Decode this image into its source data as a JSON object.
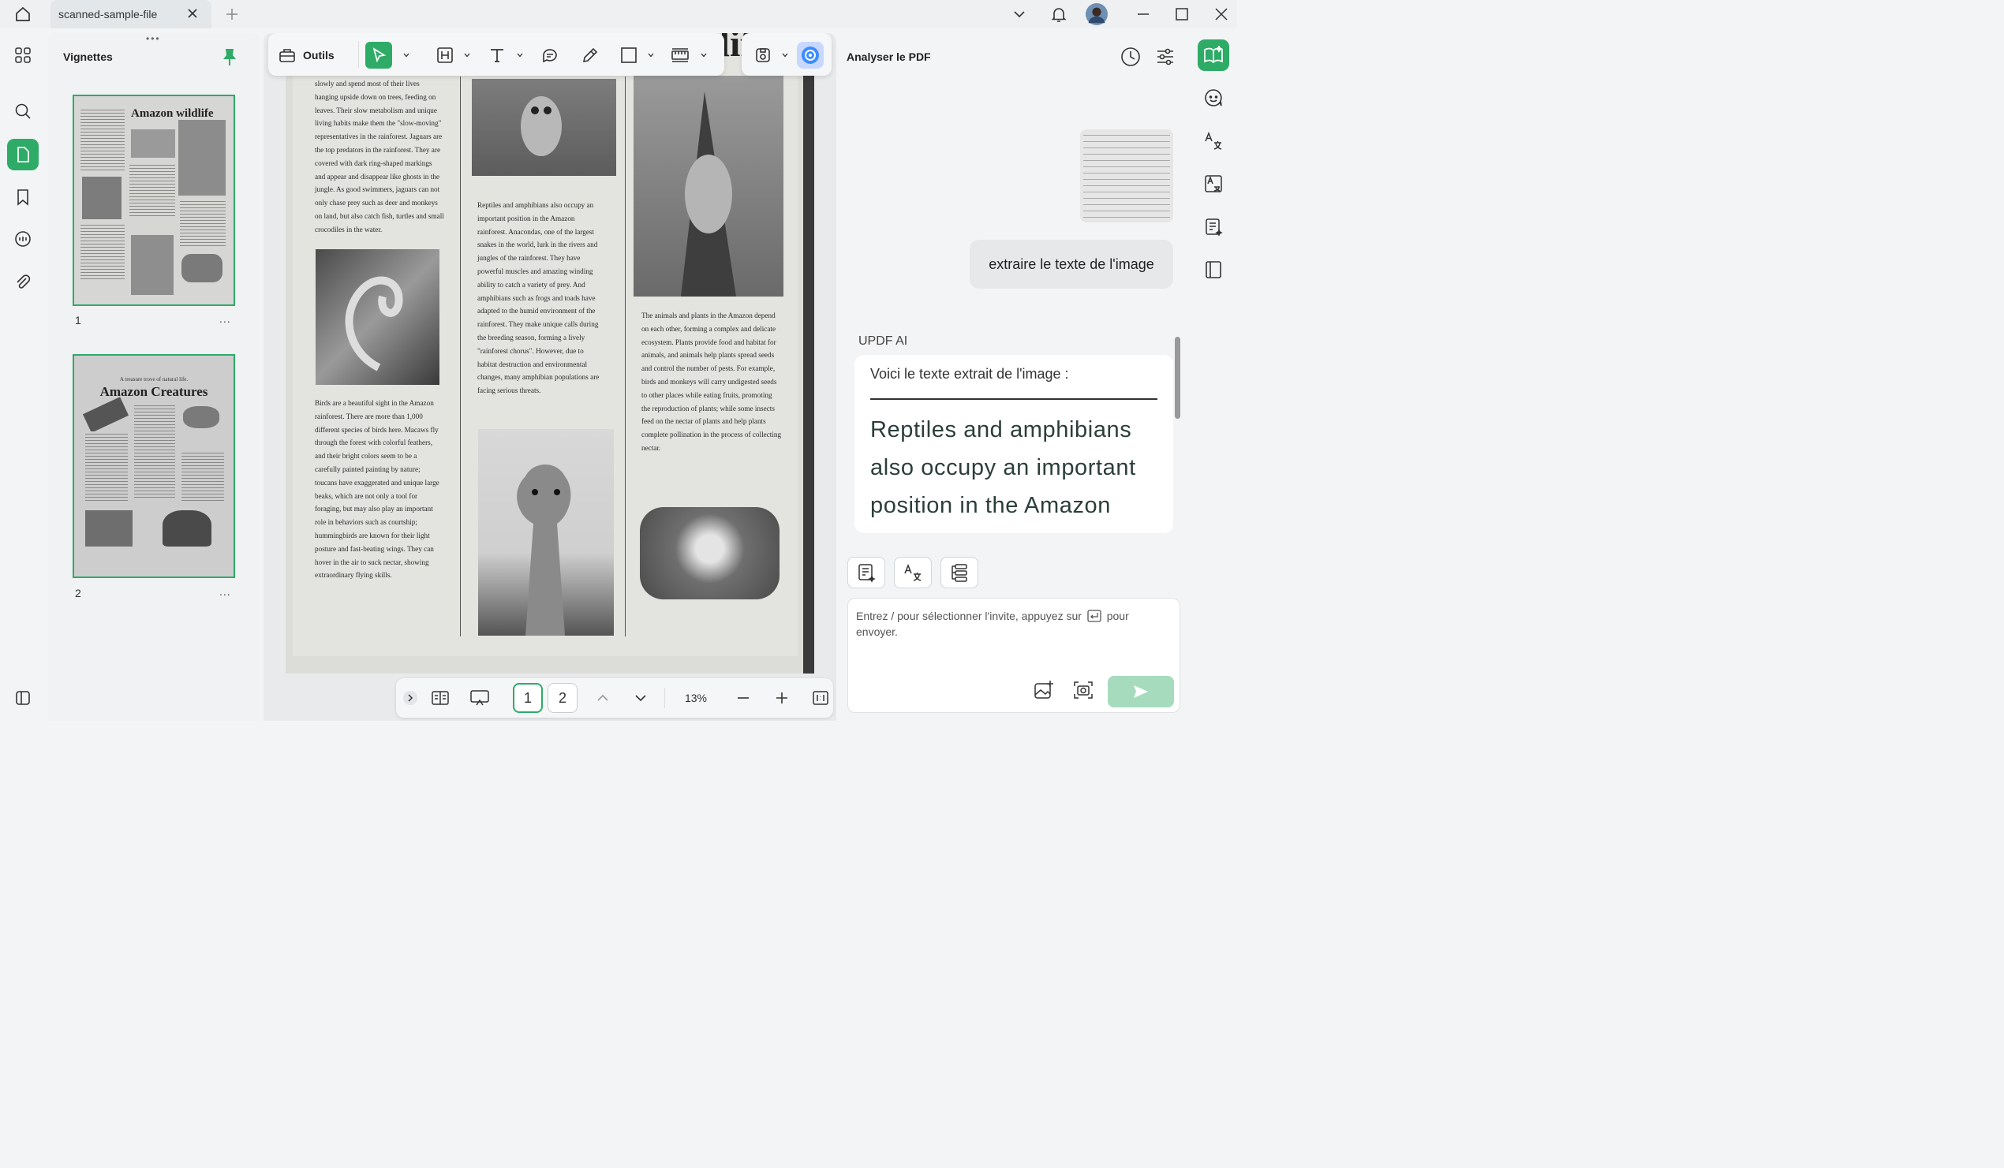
{
  "app": {
    "tab_title": "scanned-sample-file"
  },
  "thumbnails_panel": {
    "title": "Vignettes",
    "pages": [
      {
        "number": "1",
        "more": "...",
        "title": "Amazon wildlife"
      },
      {
        "number": "2",
        "more": "...",
        "kicker": "A treasure trove of natural life.",
        "title": "Amazon Creatures"
      }
    ]
  },
  "toolbar": {
    "tools_label": "Outils"
  },
  "document": {
    "title": "Amazon wildlife",
    "col1_top": "slowly and spend most of their lives hanging upside down on trees, feeding on leaves. Their slow metabolism and unique living habits make them the \"slow-moving\" representatives in the rainforest. Jaguars are the top predators in the rainforest. They are covered with dark ring-shaped markings and appear and disappear like ghosts in the jungle. As good swimmers, jaguars can not only chase prey such as deer and monkeys on land, but also catch fish, turtles and small crocodiles in the water.",
    "col1_bottom": "Birds are a beautiful sight in the Amazon rainforest. There are more than 1,000 different species of birds here. Macaws fly through the forest with colorful feathers, and their bright colors seem to be a carefully painted painting by nature; toucans have exaggerated and unique large beaks, which are not only a tool for foraging, but may also play an important role in behaviors such as courtship; hummingbirds are known for their light posture and fast-beating wings. They can hover in the air to suck nectar, showing extraordinary flying skills.",
    "col2": "Reptiles and amphibians also occupy an important position in the Amazon rainforest. Anacondas, one of the largest snakes in the world, lurk in the rivers and jungles of the rainforest. They have powerful muscles and amazing winding ability to catch a variety of prey. And amphibians such as frogs and toads have adapted to the humid environment of the rainforest. They make unique calls during the breeding season, forming a lively \"rainforest chorus\". However, due to habitat destruction and environmental changes, many amphibian populations are facing serious threats.",
    "col3": "The animals and plants in the Amazon depend on each other, forming a complex and delicate ecosystem. Plants provide food and habitat for animals, and animals help plants spread seeds and control the number of pests. For example, birds and monkeys will carry undigested seeds to other places while eating fruits, promoting the reproduction of plants; while some insects feed on the nectar of plants and help plants complete pollination in the process of collecting nectar."
  },
  "page_nav": {
    "pages": [
      "1",
      "2"
    ],
    "current": "1",
    "zoom": "13%"
  },
  "ai_panel": {
    "title": "Analyser le PDF",
    "user_message": "extraire le texte de l'image",
    "ai_name": "UPDF AI",
    "ai_intro": "Voici le texte extrait de l'image :",
    "ai_extract": "Reptiles and amphibians also occupy an important position in the Amazon",
    "input_placeholder_1": "Entrez / pour sélectionner l'invite, appuyez sur",
    "input_placeholder_2": "pour envoyer."
  },
  "colors": {
    "accent": "#2eab67",
    "send_disabled": "#a6dcbd"
  }
}
